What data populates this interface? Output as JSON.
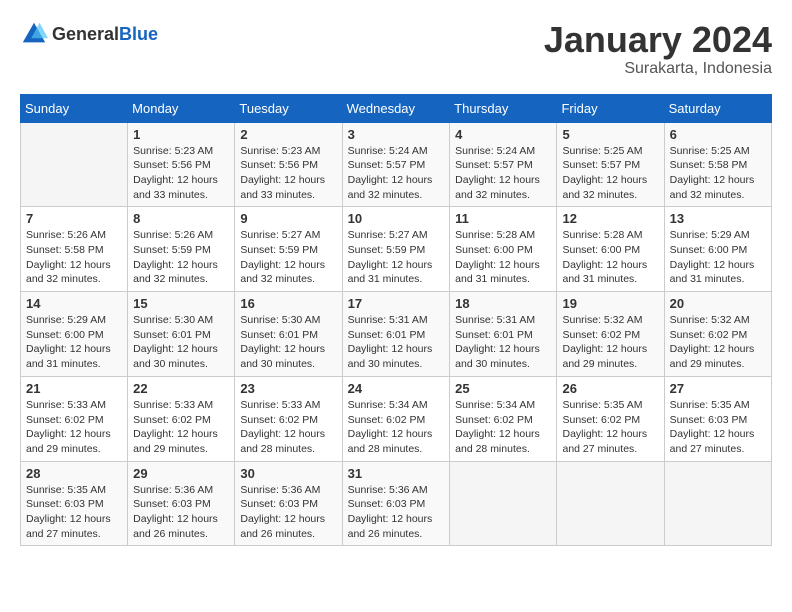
{
  "header": {
    "logo_general": "General",
    "logo_blue": "Blue",
    "month_title": "January 2024",
    "location": "Surakarta, Indonesia"
  },
  "days_of_week": [
    "Sunday",
    "Monday",
    "Tuesday",
    "Wednesday",
    "Thursday",
    "Friday",
    "Saturday"
  ],
  "weeks": [
    [
      {
        "day": "",
        "empty": true
      },
      {
        "day": "1",
        "sunrise": "5:23 AM",
        "sunset": "5:56 PM",
        "daylight": "12 hours and 33 minutes."
      },
      {
        "day": "2",
        "sunrise": "5:23 AM",
        "sunset": "5:56 PM",
        "daylight": "12 hours and 33 minutes."
      },
      {
        "day": "3",
        "sunrise": "5:24 AM",
        "sunset": "5:57 PM",
        "daylight": "12 hours and 32 minutes."
      },
      {
        "day": "4",
        "sunrise": "5:24 AM",
        "sunset": "5:57 PM",
        "daylight": "12 hours and 32 minutes."
      },
      {
        "day": "5",
        "sunrise": "5:25 AM",
        "sunset": "5:57 PM",
        "daylight": "12 hours and 32 minutes."
      },
      {
        "day": "6",
        "sunrise": "5:25 AM",
        "sunset": "5:58 PM",
        "daylight": "12 hours and 32 minutes."
      }
    ],
    [
      {
        "day": "7",
        "sunrise": "5:26 AM",
        "sunset": "5:58 PM",
        "daylight": "12 hours and 32 minutes."
      },
      {
        "day": "8",
        "sunrise": "5:26 AM",
        "sunset": "5:59 PM",
        "daylight": "12 hours and 32 minutes."
      },
      {
        "day": "9",
        "sunrise": "5:27 AM",
        "sunset": "5:59 PM",
        "daylight": "12 hours and 32 minutes."
      },
      {
        "day": "10",
        "sunrise": "5:27 AM",
        "sunset": "5:59 PM",
        "daylight": "12 hours and 31 minutes."
      },
      {
        "day": "11",
        "sunrise": "5:28 AM",
        "sunset": "6:00 PM",
        "daylight": "12 hours and 31 minutes."
      },
      {
        "day": "12",
        "sunrise": "5:28 AM",
        "sunset": "6:00 PM",
        "daylight": "12 hours and 31 minutes."
      },
      {
        "day": "13",
        "sunrise": "5:29 AM",
        "sunset": "6:00 PM",
        "daylight": "12 hours and 31 minutes."
      }
    ],
    [
      {
        "day": "14",
        "sunrise": "5:29 AM",
        "sunset": "6:00 PM",
        "daylight": "12 hours and 31 minutes."
      },
      {
        "day": "15",
        "sunrise": "5:30 AM",
        "sunset": "6:01 PM",
        "daylight": "12 hours and 30 minutes."
      },
      {
        "day": "16",
        "sunrise": "5:30 AM",
        "sunset": "6:01 PM",
        "daylight": "12 hours and 30 minutes."
      },
      {
        "day": "17",
        "sunrise": "5:31 AM",
        "sunset": "6:01 PM",
        "daylight": "12 hours and 30 minutes."
      },
      {
        "day": "18",
        "sunrise": "5:31 AM",
        "sunset": "6:01 PM",
        "daylight": "12 hours and 30 minutes."
      },
      {
        "day": "19",
        "sunrise": "5:32 AM",
        "sunset": "6:02 PM",
        "daylight": "12 hours and 29 minutes."
      },
      {
        "day": "20",
        "sunrise": "5:32 AM",
        "sunset": "6:02 PM",
        "daylight": "12 hours and 29 minutes."
      }
    ],
    [
      {
        "day": "21",
        "sunrise": "5:33 AM",
        "sunset": "6:02 PM",
        "daylight": "12 hours and 29 minutes."
      },
      {
        "day": "22",
        "sunrise": "5:33 AM",
        "sunset": "6:02 PM",
        "daylight": "12 hours and 29 minutes."
      },
      {
        "day": "23",
        "sunrise": "5:33 AM",
        "sunset": "6:02 PM",
        "daylight": "12 hours and 28 minutes."
      },
      {
        "day": "24",
        "sunrise": "5:34 AM",
        "sunset": "6:02 PM",
        "daylight": "12 hours and 28 minutes."
      },
      {
        "day": "25",
        "sunrise": "5:34 AM",
        "sunset": "6:02 PM",
        "daylight": "12 hours and 28 minutes."
      },
      {
        "day": "26",
        "sunrise": "5:35 AM",
        "sunset": "6:02 PM",
        "daylight": "12 hours and 27 minutes."
      },
      {
        "day": "27",
        "sunrise": "5:35 AM",
        "sunset": "6:03 PM",
        "daylight": "12 hours and 27 minutes."
      }
    ],
    [
      {
        "day": "28",
        "sunrise": "5:35 AM",
        "sunset": "6:03 PM",
        "daylight": "12 hours and 27 minutes."
      },
      {
        "day": "29",
        "sunrise": "5:36 AM",
        "sunset": "6:03 PM",
        "daylight": "12 hours and 26 minutes."
      },
      {
        "day": "30",
        "sunrise": "5:36 AM",
        "sunset": "6:03 PM",
        "daylight": "12 hours and 26 minutes."
      },
      {
        "day": "31",
        "sunrise": "5:36 AM",
        "sunset": "6:03 PM",
        "daylight": "12 hours and 26 minutes."
      },
      {
        "day": "",
        "empty": true
      },
      {
        "day": "",
        "empty": true
      },
      {
        "day": "",
        "empty": true
      }
    ]
  ],
  "labels": {
    "sunrise_label": "Sunrise:",
    "sunset_label": "Sunset:",
    "daylight_label": "Daylight:"
  }
}
